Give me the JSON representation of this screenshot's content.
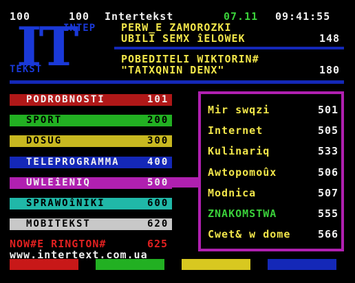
{
  "header": {
    "page": "100",
    "subpage": "100",
    "service": "Intertekst",
    "date": "07.11",
    "time": "09:41:55"
  },
  "logo": {
    "big": "IT",
    "top": "INTEP",
    "bottom": "TEKST"
  },
  "headlines": [
    {
      "line1": "PERW_E ZAMOROZKI",
      "line2": "UBILI SEMX îELOWEK",
      "page": "148"
    },
    {
      "line1": "POBEDITELI WIKTORIN#",
      "line2": "\"TATXQNIN DENX\"",
      "page": "180"
    }
  ],
  "menu": [
    {
      "label": "PODROBNOSTI",
      "page": "101",
      "color": "#b01818",
      "text_color": "#f0f0f0"
    },
    {
      "label": "SPORT",
      "page": "200",
      "color": "#22b022",
      "text_color": "#000000"
    },
    {
      "label": "DOSUG",
      "page": "300",
      "color": "#c8b820",
      "text_color": "#000000"
    },
    {
      "label": "TELEPROGRAMMA",
      "page": "400",
      "color": "#1428b8",
      "text_color": "#f0f0f0"
    },
    {
      "label": "UWLEîENIQ",
      "page": "500",
      "color": "#b020b0",
      "text_color": "#f0f0f0"
    },
    {
      "label": "SPRAWOîNIKI",
      "page": "600",
      "color": "#20b8a8",
      "text_color": "#000000"
    },
    {
      "label": "MOBITEKST",
      "page": "620",
      "color": "#c8c8c8",
      "text_color": "#000000"
    }
  ],
  "submenu": [
    {
      "label": "Mir swqzi",
      "page": "501",
      "color": "#f2e64a"
    },
    {
      "label": "Internet",
      "page": "505",
      "color": "#f2e64a"
    },
    {
      "label": "Kulinariq",
      "page": "533",
      "color": "#f2e64a"
    },
    {
      "label": "Awtopomoûx",
      "page": "506",
      "color": "#f2e64a"
    },
    {
      "label": "Modnica",
      "page": "507",
      "color": "#f2e64a"
    },
    {
      "label": "ZNAKOMSTWA",
      "page": "555",
      "color": "#3ad03a"
    },
    {
      "label": "Cwet& w dome",
      "page": "566",
      "color": "#f2e64a"
    }
  ],
  "ringtone": {
    "label": "NOW#E RINGTON#",
    "page": "625"
  },
  "url": "www.intertext.com.ua",
  "fastext": {
    "red": "#c81818",
    "green": "#22b022",
    "yellow": "#d8c820",
    "blue": "#1428b8"
  },
  "colors": {
    "accent_blue": "#1428b8",
    "magenta": "#b020b0"
  }
}
